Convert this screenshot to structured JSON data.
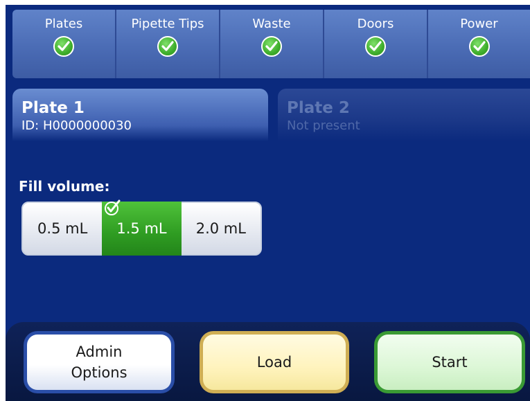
{
  "status": {
    "items": [
      {
        "label": "Plates",
        "state": "ok",
        "icon": "check-circle-icon"
      },
      {
        "label": "Pipette Tips",
        "state": "ok",
        "icon": "check-circle-icon"
      },
      {
        "label": "Waste",
        "state": "ok",
        "icon": "check-circle-icon"
      },
      {
        "label": "Doors",
        "state": "ok",
        "icon": "check-circle-icon"
      },
      {
        "label": "Power",
        "state": "ok",
        "icon": "check-circle-icon"
      }
    ]
  },
  "plates": [
    {
      "title": "Plate 1",
      "subtitle": "ID: H0000000030",
      "active": true
    },
    {
      "title": "Plate 2",
      "subtitle": "Not present",
      "active": false
    }
  ],
  "fill_volume": {
    "label": "Fill volume:",
    "options": [
      "0.5 mL",
      "1.5 mL",
      "2.0 mL"
    ],
    "selected": "1.5 mL"
  },
  "buttons": {
    "admin_line1": "Admin",
    "admin_line2": "Options",
    "load": "Load",
    "start": "Start"
  },
  "colors": {
    "background": "#0b2a7e",
    "status_ok": "#3fae2c",
    "selected_option": "#2f9c22",
    "admin_border": "#2a4ea8",
    "load_border": "#cfae54",
    "start_border": "#3a9a34"
  }
}
